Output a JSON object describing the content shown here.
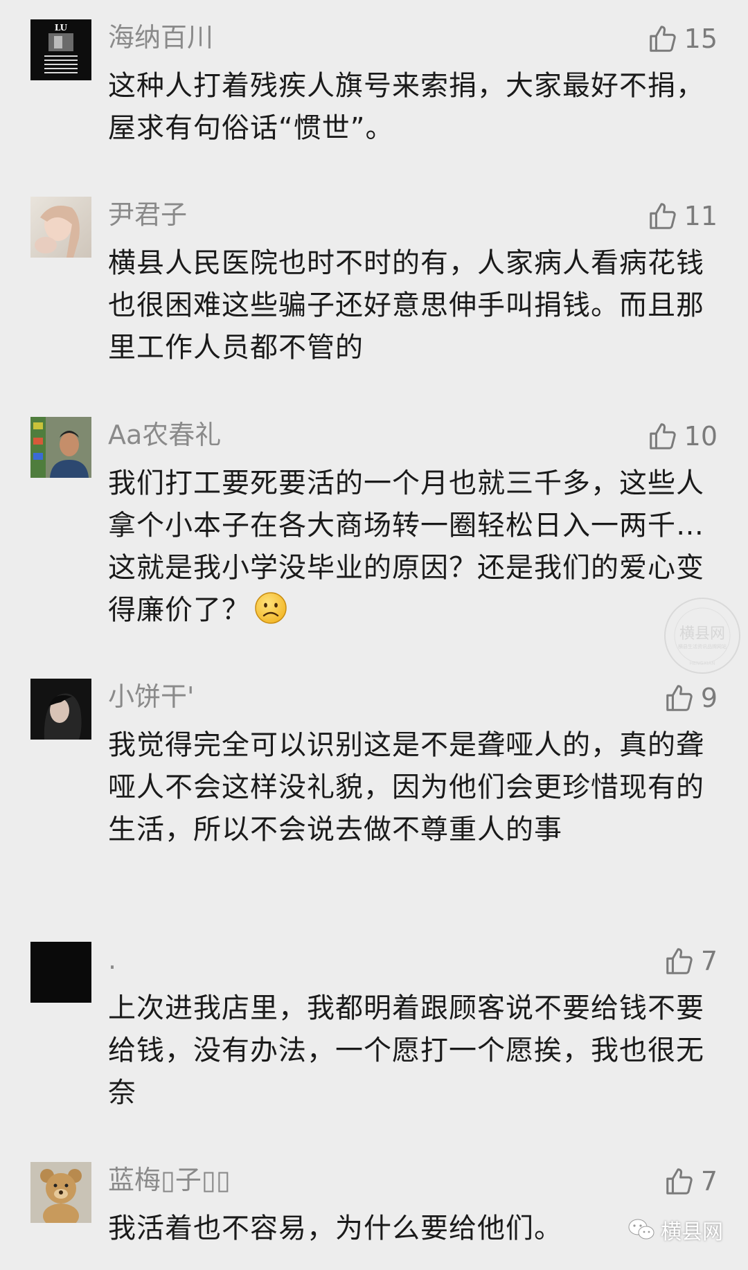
{
  "comments": [
    {
      "author": "海纳百川",
      "likes": "15",
      "text": "这种人打着残疾人旗号来索捐，大家最好不捐，屋求有句俗话“惯世”。",
      "avatar": "lu-text-avatar-icon"
    },
    {
      "author": "尹君子",
      "likes": "11",
      "text": "横县人民医院也时不时的有，人家病人看病花钱也很困难这些骗子还好意思伸手叫捐钱。而且那里工作人员都不管的",
      "avatar": "woman-photo-avatar-icon"
    },
    {
      "author": "Aa农春礼",
      "likes": "10",
      "text": "我们打工要死要活的一个月也就三千多，这些人拿个小本子在各大商场转一圈轻松日入一两千…这就是我小学没毕业的原因？还是我们的爱心变得廉价了？",
      "avatar": "man-photo-avatar-icon",
      "emoji": "sad-face-emoji-icon"
    },
    {
      "author": "小饼干'",
      "likes": "9",
      "text": "我觉得完全可以识别这是不是聋哑人的，真的聋哑人不会这样没礼貌，因为他们会更珍惜现有的生活，所以不会说去做不尊重人的事",
      "avatar": "dark-portrait-avatar-icon"
    },
    {
      "author": ".",
      "likes": "7",
      "text": "上次进我店里，我都明着跟顾客说不要给钱不要给钱，没有办法，一个愿打一个愿挨，我也很无奈",
      "avatar": "black-avatar-icon"
    },
    {
      "author": "蓝梅▯子▯▯",
      "likes": "7",
      "text": "我活着也不容易，为什么要给他们。",
      "avatar": "teddy-bear-avatar-icon"
    }
  ],
  "watermark": {
    "main": "横县网",
    "sub": "横县生活资讯品牌网站",
    "latin": "HENGXIAN"
  },
  "brand": {
    "label": "横县网"
  },
  "colors": {
    "background": "#ededed",
    "author": "#8a8a8a",
    "text": "#1a1a1a",
    "like": "#7b7b7b"
  }
}
